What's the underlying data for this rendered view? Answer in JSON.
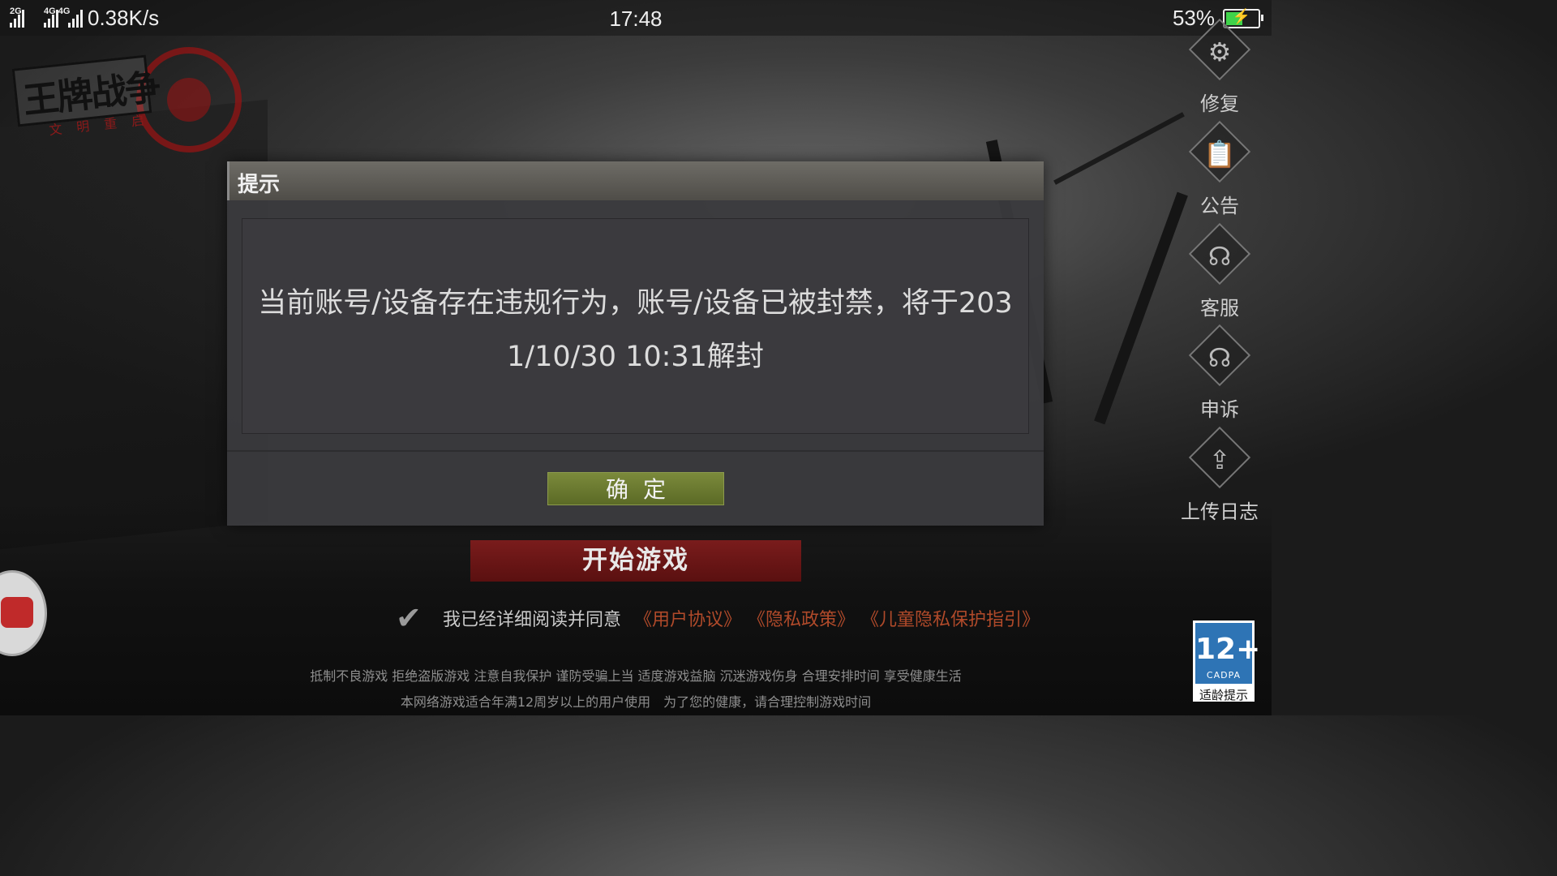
{
  "status_bar": {
    "signal1_tag": "2G",
    "signal2_tag": "4G 4G",
    "net_speed": "0.38K/s",
    "time": "17:48",
    "battery_percent": "53%",
    "battery_level": 0.53,
    "battery_color": "#3fd34a"
  },
  "logo": {
    "title": "王牌战争",
    "subtitle": "文明重启"
  },
  "side_tools": [
    {
      "label": "修复",
      "icon": "gear-icon"
    },
    {
      "label": "公告",
      "icon": "announcement-icon"
    },
    {
      "label": "客服",
      "icon": "customer-service-icon"
    },
    {
      "label": "申诉",
      "icon": "appeal-icon"
    },
    {
      "label": "上传日志",
      "icon": "upload-icon"
    }
  ],
  "dialog": {
    "title": "提示",
    "message": "当前账号/设备存在违规行为，账号/设备已被封禁，将于2031/10/30 10:31解封",
    "confirm_label": "确定"
  },
  "start_button": "开始游戏",
  "agreement": {
    "text": "我已经详细阅读并同意",
    "links": [
      "《用户协议》",
      "《隐私政策》",
      "《儿童隐私保护指引》"
    ],
    "link_color": "#b04a2a"
  },
  "footer": {
    "line1": "抵制不良游戏 拒绝盗版游戏 注意自我保护 谨防受骗上当 适度游戏益脑 沉迷游戏伤身 合理安排时间 享受健康生活",
    "line2": "本网络游戏适合年满12周岁以上的用户使用　为了您的健康，请合理控制游戏时间"
  },
  "age_badge": {
    "rating": "12+",
    "org": "CADPA",
    "label": "适龄提示"
  }
}
